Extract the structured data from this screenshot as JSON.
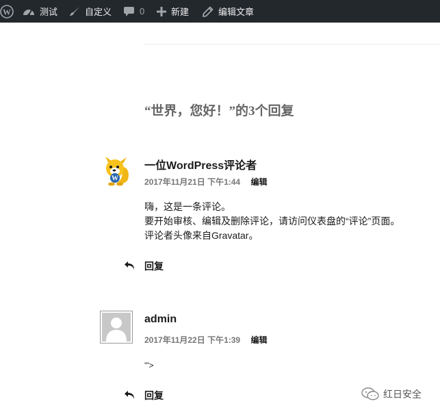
{
  "adminbar": {
    "site_name": "测试",
    "customize": "自定义",
    "comments_count": "0",
    "new": "新建",
    "edit_post": "编辑文章"
  },
  "comments_title": "“世界，您好！”的3个回复",
  "comments": [
    {
      "author": "一位WordPress评论者",
      "date": "2017年11月21日 下午1:44",
      "edit": "编辑",
      "lines": [
        "嗨，这是一条评论。",
        "要开始审核、编辑及删除评论，请访问仪表盘的“评论”页面。",
        "评论者头像来自Gravatar。"
      ],
      "reply": "回复"
    },
    {
      "author": "admin",
      "date": "2017年11月22日 下午1:39",
      "edit": "编辑",
      "lines": [
        "'\">"
      ],
      "reply": "回复"
    }
  ],
  "watermark": "红日安全"
}
